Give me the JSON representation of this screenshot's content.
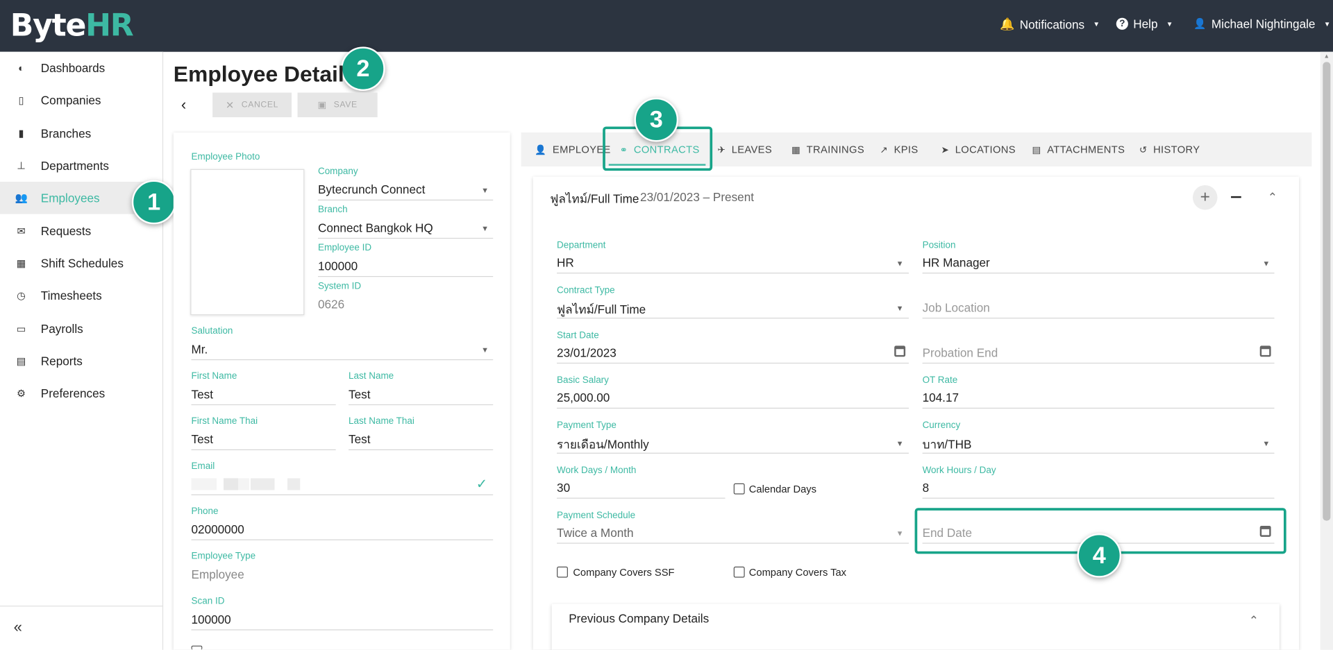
{
  "app": {
    "logo_by": "B",
    "logo_yte": "yte",
    "logo_hr": "HR"
  },
  "topnav": {
    "notifications": "Notifications",
    "help": "Help",
    "user": "Michael Nightingale"
  },
  "sidebar": {
    "items": [
      {
        "label": "Dashboards",
        "icon": "gauge-icon"
      },
      {
        "label": "Companies",
        "icon": "building-icon"
      },
      {
        "label": "Branches",
        "icon": "branch-building-icon"
      },
      {
        "label": "Departments",
        "icon": "org-chart-icon"
      },
      {
        "label": "Employees",
        "icon": "users-icon",
        "active": true
      },
      {
        "label": "Requests",
        "icon": "envelope-icon"
      },
      {
        "label": "Shift Schedules",
        "icon": "calendar-icon"
      },
      {
        "label": "Timesheets",
        "icon": "clock-icon"
      },
      {
        "label": "Payrolls",
        "icon": "money-icon"
      },
      {
        "label": "Reports",
        "icon": "pdf-icon"
      },
      {
        "label": "Preferences",
        "icon": "gears-icon"
      }
    ],
    "collapse": "«"
  },
  "annotations": {
    "b1": "1",
    "b2": "2",
    "b3": "3",
    "b4": "4"
  },
  "page": {
    "title": "Employee Detail",
    "back": "‹",
    "cancel": "CANCEL",
    "save": "SAVE"
  },
  "employee": {
    "photo_label": "Employee Photo",
    "company_label": "Company",
    "company": "Bytecrunch Connect",
    "branch_label": "Branch",
    "branch": "Connect Bangkok HQ",
    "employee_id_label": "Employee ID",
    "employee_id": "100000",
    "system_id_label": "System ID",
    "system_id": "0626",
    "salutation_label": "Salutation",
    "salutation": "Mr.",
    "first_name_label": "First Name",
    "first_name": "Test",
    "last_name_label": "Last Name",
    "last_name": "Test",
    "first_name_thai_label": "First Name Thai",
    "first_name_thai": "Test",
    "last_name_thai_label": "Last Name Thai",
    "last_name_thai": "Test",
    "email_label": "Email",
    "phone_label": "Phone",
    "phone": "02000000",
    "employee_type_label": "Employee Type",
    "employee_type": "Employee",
    "scan_id_label": "Scan ID",
    "scan_id": "100000"
  },
  "tabs": [
    "EMPLOYEE",
    "CONTRACTS",
    "LEAVES",
    "TRAININGS",
    "KPIS",
    "LOCATIONS",
    "ATTACHMENTS",
    "HISTORY"
  ],
  "contract": {
    "header_type": "ฟูลไทม์/Full Time",
    "header_dates": "23/01/2023 – Present",
    "department_label": "Department",
    "department": "HR",
    "position_label": "Position",
    "position": "HR Manager",
    "contract_type_label": "Contract Type",
    "contract_type": "ฟูลไทม์/Full Time",
    "job_location_placeholder": "Job Location",
    "start_date_label": "Start Date",
    "start_date": "23/01/2023",
    "probation_end_placeholder": "Probation End",
    "basic_salary_label": "Basic Salary",
    "basic_salary": "25,000.00",
    "ot_rate_label": "OT Rate",
    "ot_rate": "104.17",
    "payment_type_label": "Payment Type",
    "payment_type": "รายเดือน/Monthly",
    "currency_label": "Currency",
    "currency": "บาท/THB",
    "work_days_label": "Work Days / Month",
    "work_days": "30",
    "calendar_days_label": "Calendar Days",
    "work_hours_label": "Work Hours / Day",
    "work_hours": "8",
    "payment_schedule_label": "Payment Schedule",
    "payment_schedule": "Twice a Month",
    "end_date_placeholder": "End Date",
    "covers_ssf_label": "Company Covers SSF",
    "covers_tax_label": "Company Covers Tax",
    "previous_company_label": "Previous Company Details"
  },
  "colors": {
    "accent": "#3db9a3",
    "topbar": "#2c3440",
    "badge": "#17a489"
  }
}
